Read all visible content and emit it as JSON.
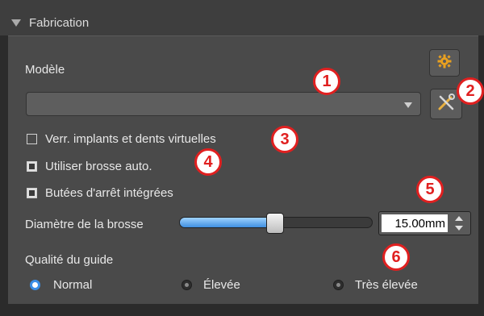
{
  "header": {
    "title": "Fabrication"
  },
  "model": {
    "label": "Modèle",
    "selected": ""
  },
  "checkboxes": [
    {
      "label": "Verr. implants et dents virtuelles",
      "checked": false
    },
    {
      "label": "Utiliser brosse auto.",
      "checked": true
    },
    {
      "label": "Butées d'arrêt intégrées",
      "checked": true
    }
  ],
  "brush": {
    "label": "Diamètre de la brosse",
    "value_text": "15.00mm",
    "slider_fraction": 0.5
  },
  "guide_quality": {
    "label": "Qualité du guide",
    "options": [
      {
        "label": "Normal",
        "selected": true
      },
      {
        "label": "Élevée",
        "selected": false
      },
      {
        "label": "Très élevée",
        "selected": false
      }
    ]
  },
  "callouts": [
    "1",
    "2",
    "3",
    "4",
    "5",
    "6"
  ],
  "colors": {
    "accent": "#3a8ee6",
    "callout_red": "#e02020",
    "gear_orange": "#e8a020"
  },
  "icons": {
    "settings": "gear-icon",
    "tools": "tools-icon",
    "collapse": "collapse-arrow-icon"
  }
}
